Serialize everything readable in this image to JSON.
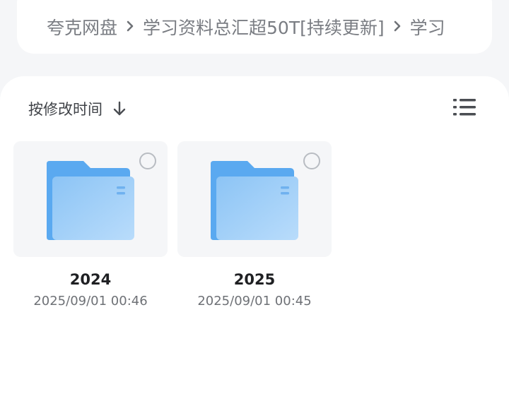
{
  "breadcrumb": {
    "items": [
      {
        "label": "夸克网盘"
      },
      {
        "label": "学习资料总汇超50T[持续更新]"
      },
      {
        "label": "学习"
      }
    ],
    "separator_icon": "chevron-right-icon"
  },
  "toolbar": {
    "sort_label": "按修改时间",
    "sort_icon": "arrow-down-icon",
    "view_toggle_icon": "list-view-icon"
  },
  "files": [
    {
      "name": "2024",
      "modified": "2025/09/01 00:46",
      "icon": "folder-icon"
    },
    {
      "name": "2025",
      "modified": "2025/09/01 00:45",
      "icon": "folder-icon"
    }
  ],
  "colors": {
    "background": "#f5f6f8",
    "folder_back": "#5aa9f0",
    "folder_front": "#9ccdf7",
    "text_primary": "#1f2023",
    "text_secondary": "#6e7176"
  }
}
